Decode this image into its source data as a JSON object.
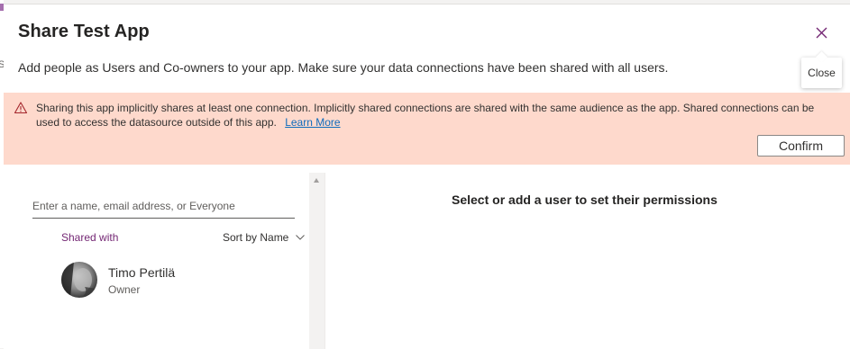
{
  "dialog": {
    "title": "Share Test App",
    "subtitle": "Add people as Users and Co-owners to your app. Make sure your data connections have been shared with all users.",
    "close_tooltip": "Close"
  },
  "warning": {
    "text": "Sharing this app implicitly shares at least one connection. Implicitly shared connections are shared with the same audience as the app. Shared connections can be used to access the datasource outside of this app.",
    "link_label": "Learn More",
    "confirm_label": "Confirm",
    "color": "#fed9cc",
    "icon": "warning-triangle-icon"
  },
  "people": {
    "search_placeholder": "Enter a name, email address, or Everyone",
    "shared_with_label": "Shared with",
    "sort_label": "Sort by Name",
    "users": [
      {
        "name": "Timo Pertilä",
        "role": "Owner"
      }
    ]
  },
  "detail": {
    "empty_message": "Select or add a user to set their permissions"
  },
  "colors": {
    "accent": "#742774",
    "link": "#0f6cbd"
  }
}
